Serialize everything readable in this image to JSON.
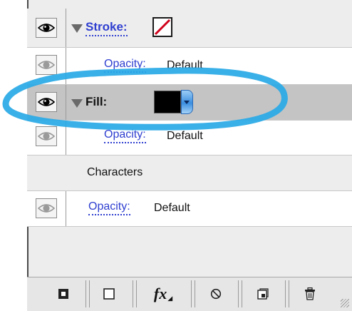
{
  "rows": {
    "stroke": {
      "label": "Stroke:"
    },
    "stroke_opacity": {
      "label": "Opacity:",
      "value": "Default"
    },
    "fill": {
      "label": "Fill:"
    },
    "fill_opacity": {
      "label": "Opacity:",
      "value": "Default"
    },
    "characters": {
      "label": "Characters"
    },
    "char_opacity": {
      "label": "Opacity:",
      "value": "Default"
    }
  },
  "toolbar": {
    "fx_label": "fx"
  },
  "colors": {
    "link_blue": "#2f3fd0",
    "selected_row": "#c4c4c4",
    "highlight_stroke": "#29a9e6",
    "no_color_red": "#d0021b",
    "fill_swatch": "#000000"
  },
  "icons": [
    "eye-icon",
    "disclosure-triangle-icon",
    "none-swatch-icon",
    "color-swatch-dropdown",
    "add-stroke-icon",
    "add-fill-icon",
    "fx-icon",
    "clear-appearance-icon",
    "duplicate-item-icon",
    "trash-icon"
  ]
}
